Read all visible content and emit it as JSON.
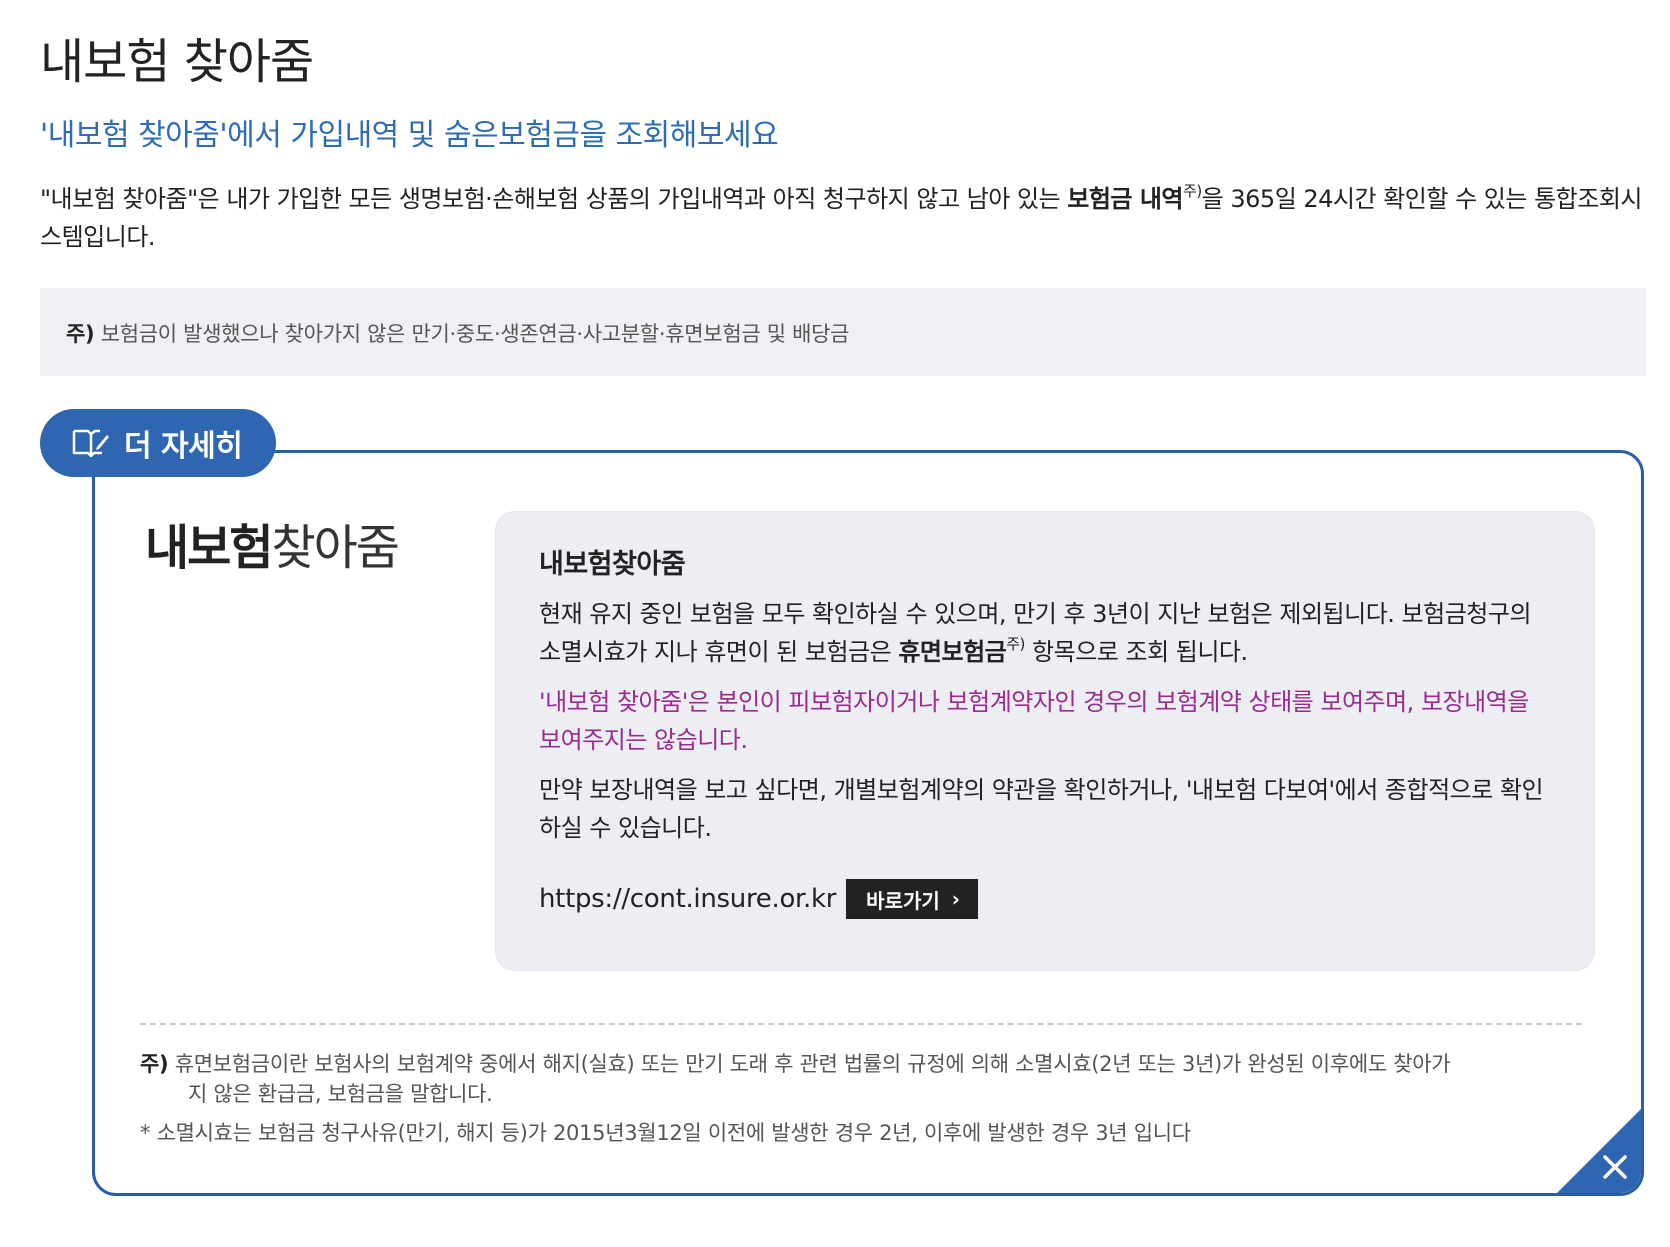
{
  "header": {
    "title": "내보험 찾아줌",
    "subtitle": "'내보험 찾아줌'에서 가입내역 및 숨은보험금을 조회해보세요"
  },
  "intro": {
    "text_before": "\"내보험 찾아줌\"은 내가 가입한 모든 생명보험·손해보험 상품의 가입내역과 아직 청구하지 않고 남아 있는 ",
    "bold": "보험금 내역",
    "sup": "주)",
    "text_after": "을 365일 24시간 확인할 수 있는 통합조회시스템입니다."
  },
  "notice": {
    "mark": "주)",
    "text": "보험금이 발생했으나 찾아가지 않은 만기·중도·생존연금·사고분할·휴면보험금 및 배당금"
  },
  "detail": {
    "tab_label": "더 자세히",
    "tab_icon": "book-icon",
    "logo_bold": "내보험",
    "logo_light": "찾아줌",
    "card_title": "내보험찾아줌",
    "p1_before": "현재 유지 중인 보험을 모두 확인하실 수 있으며, 만기 후 3년이 지난 보험은 제외됩니다. 보험금청구의 소멸시효가 지나 휴면이 된 보험금은 ",
    "p1_bold": "휴면보험금",
    "p1_sup": "주)",
    "p1_after": " 항목으로 조회 됩니다.",
    "p2": "'내보험 찾아줌'은 본인이 피보험자이거나 보험계약자인 경우의 보험계약 상태를 보여주며, 보장내역을 보여주지는 않습니다.",
    "p3": "만약 보장내역을 보고 싶다면, 개별보험계약의 약관을 확인하거나, '내보험 다보여'에서 종합적으로 확인하실 수 있습니다.",
    "url": "https://cont.insure.or.kr",
    "go_label": "바로가기",
    "footnote_mark": "주)",
    "footnote_line1": "휴면보험금이란 보험사의 보험계약 중에서 해지(실효) 또는 만기 도래 후 관련 법률의 규정에 의해 소멸시효(2년 또는 3년)가 완성된 이후에도 찾아가",
    "footnote_line2": "지 않은 환급금, 보험금을 말합니다.",
    "footnote2": "* 소멸시효는 보험금 청구사유(만기, 해지 등)가 2015년3월12일 이전에 발생한 경우 2년, 이후에 발생한 경우 3년 입니다",
    "close_icon": "close-icon"
  },
  "colors": {
    "accent_blue": "#2e66b1",
    "subtitle_blue": "#2e6cb5",
    "purple_text": "#9b2b8e",
    "notice_bg": "#eef0f3",
    "card_bg": "#eceef3"
  }
}
